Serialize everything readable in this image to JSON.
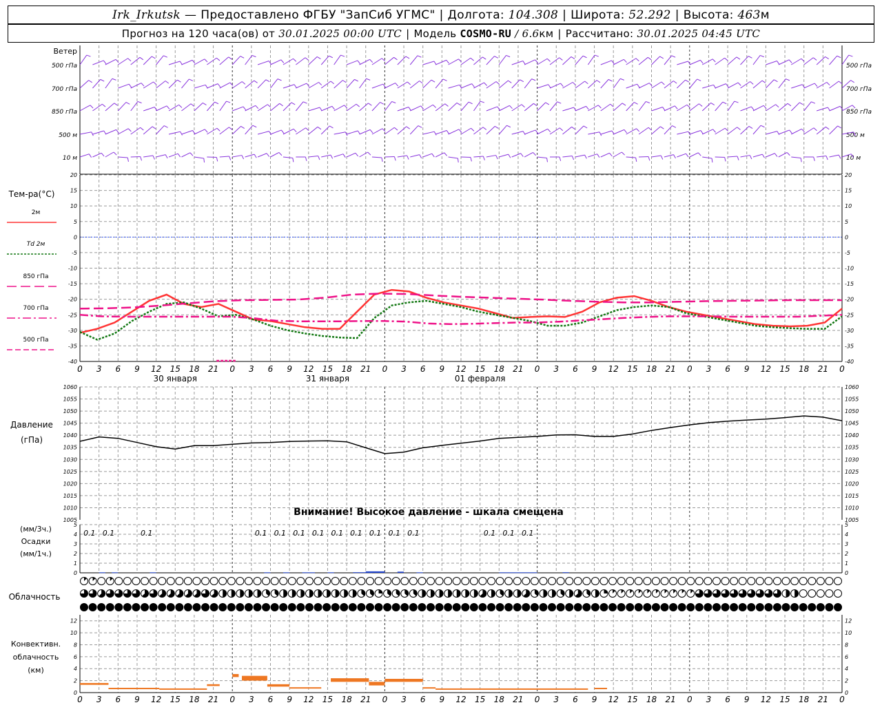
{
  "header": {
    "station": "Irk_Irkutsk",
    "dash": "—",
    "provider": "Предоставлено ФГБУ \"ЗапСиб УГМС\"",
    "lon_label": "Долгота:",
    "lon_value": "104.308",
    "lat_label": "Широта:",
    "lat_value": "52.292",
    "alt_label": "Высота:",
    "alt_value": "463",
    "alt_unit": "м",
    "forecast_prefix": "Прогноз на 120 часа(ов) от",
    "forecast_start": "30.01.2025 00:00 UTC",
    "model_label": "Модель",
    "model_name": "COSMO-RU",
    "model_res": "/ 6.6",
    "model_res_unit": "км",
    "calc_label": "Рассчитано:",
    "calc_time": "30.01.2025 04:45 UTC"
  },
  "chart_data": [
    {
      "type": "wind-barbs",
      "panel": "wind",
      "title": "Ветер",
      "levels": [
        "500 гПа",
        "700 гПа",
        "850 гПа",
        "500 м",
        "10  м"
      ]
    },
    {
      "type": "line",
      "panel": "temperature",
      "title": "Тем-ра(°C)",
      "ylim": [
        -40,
        20
      ],
      "yticks": [
        20,
        15,
        10,
        5,
        0,
        -5,
        -10,
        -15,
        -20,
        -25,
        -30,
        -35,
        -40
      ],
      "x_hours": [
        0,
        3,
        6,
        9,
        12,
        15,
        18,
        21,
        24,
        27,
        30,
        33,
        36,
        39,
        42,
        45,
        48,
        51,
        54,
        57,
        60,
        63,
        66,
        69,
        72,
        75,
        78,
        81,
        84,
        87,
        90,
        93,
        96,
        99,
        102,
        105,
        108,
        111,
        114,
        117,
        120
      ],
      "series": [
        {
          "name": "2м",
          "color": "#ff3333",
          "dash": "solid",
          "values": [
            -30.8,
            -29.5,
            -27.5,
            -24,
            -20.5,
            -18.5,
            -21.5,
            -22.5,
            -21.5,
            -24,
            -26.5,
            -27,
            -28,
            -29,
            -29.5,
            -29.5,
            -24,
            -18.5,
            -17,
            -17.5,
            -19.5,
            -21,
            -22,
            -23,
            -24.5,
            -26,
            -25.7,
            -25.5,
            -25.7,
            -24,
            -21,
            -19.5,
            -19,
            -20.5,
            -22.5,
            -24,
            -25,
            -26,
            -27,
            -28,
            -28.5,
            -28.7,
            -28.5,
            -27.5,
            -23
          ]
        },
        {
          "name": "Td 2м",
          "color": "#117711",
          "dash": "dot",
          "values": [
            -30.5,
            -33,
            -31,
            -27,
            -24,
            -21.5,
            -21,
            -23,
            -25.5,
            -25,
            -26.5,
            -28.5,
            -30,
            -31,
            -31.8,
            -32.3,
            -32.5,
            -26,
            -22,
            -21,
            -20.5,
            -21.5,
            -22.5,
            -24,
            -25,
            -26,
            -27,
            -28.5,
            -28.5,
            -27.5,
            -25.5,
            -23.5,
            -22.5,
            -22,
            -22.5,
            -24.5,
            -25.5,
            -26.5,
            -27.5,
            -28.5,
            -29,
            -29.3,
            -29.5,
            -29.5,
            -25.5
          ]
        },
        {
          "name": "850 гПа",
          "color": "#ee1188",
          "dash": "longdash",
          "values": [
            -23,
            -22.9,
            -22.6,
            -22,
            -21.3,
            -20.6,
            -20.3,
            -20.2,
            -20.1,
            -19.5,
            -18.5,
            -18.2,
            -18.3,
            -18.8,
            -19.2,
            -19.5,
            -19.8,
            -20.1,
            -20.5,
            -20.8,
            -21,
            -21,
            -20.8,
            -20.6,
            -20.5,
            -20.4,
            -20.3,
            -20.3,
            -20.3
          ]
        },
        {
          "name": "700 гПа",
          "color": "#ee1188",
          "dash": "dashdot",
          "values": [
            -25,
            -25.5,
            -25.6,
            -25.6,
            -25.6,
            -25.6,
            -25.6,
            -25.6,
            -26.1,
            -26.9,
            -27.1,
            -27.1,
            -27.1,
            -27,
            -27,
            -27.2,
            -27.8,
            -28,
            -27.9,
            -27.7,
            -27.5,
            -27.5,
            -27.2,
            -26.8,
            -26.4,
            -26,
            -25.7,
            -25.5,
            -25.5,
            -25.5,
            -25.6,
            -25.6,
            -25.6,
            -25.6,
            -25.3,
            -25
          ]
        },
        {
          "name": "500 гПа",
          "color": "#ee1188",
          "dash": "dash",
          "values": [
            -40,
            -40
          ]
        }
      ]
    },
    {
      "type": "line",
      "panel": "pressure",
      "title": "Давление",
      "ylabel": "(гПа)",
      "ylim": [
        1005,
        1060
      ],
      "yticks": [
        1060,
        1055,
        1050,
        1045,
        1040,
        1035,
        1030,
        1025,
        1020,
        1015,
        1010,
        1005
      ],
      "x_hours": [
        0,
        3,
        6,
        9,
        12,
        15,
        18,
        21,
        24,
        27,
        30,
        33,
        36,
        39,
        42,
        45,
        48,
        51,
        54,
        57,
        60,
        63,
        66,
        69,
        72,
        75,
        78,
        81,
        84,
        87,
        90,
        93,
        96,
        99,
        102,
        105,
        108,
        111,
        114,
        117,
        120
      ],
      "series": [
        {
          "name": "",
          "color": "#000000",
          "values": [
            1037.5,
            1039.3,
            1038.7,
            1037,
            1035.3,
            1034.3,
            1035.7,
            1035.7,
            1036.3,
            1036.8,
            1037,
            1037.4,
            1037.6,
            1037.7,
            1037.3,
            1034.8,
            1032.4,
            1033,
            1034.8,
            1035.8,
            1036.7,
            1037.6,
            1038.7,
            1039.1,
            1039.5,
            1040.1,
            1040.2,
            1039.5,
            1039.5,
            1040.5,
            1042,
            1043.2,
            1044.3,
            1045.2,
            1045.8,
            1046.3,
            1046.7,
            1047.3,
            1048,
            1047.5,
            1046
          ]
        }
      ],
      "note": "Внимание! Высокое давление - шкала смещена"
    },
    {
      "type": "bar",
      "panel": "precipitation",
      "title": "Осадки",
      "ylabel_top": "(мм/3ч.)",
      "ylabel_bottom": "(мм/1ч.)",
      "ylim": [
        0,
        5
      ],
      "yticks": [
        5,
        4,
        3,
        2,
        1,
        0
      ],
      "labels": [
        {
          "hour": 1.5,
          "text": "0.1"
        },
        {
          "hour": 4.5,
          "text": "0.1"
        },
        {
          "hour": 10.5,
          "text": "0.1"
        },
        {
          "hour": 28.5,
          "text": "0.1"
        },
        {
          "hour": 31.5,
          "text": "0.1"
        },
        {
          "hour": 34.5,
          "text": "0.1"
        },
        {
          "hour": 37.5,
          "text": "0.1"
        },
        {
          "hour": 40.5,
          "text": "0.1"
        },
        {
          "hour": 43.5,
          "text": "0.1"
        },
        {
          "hour": 46.5,
          "text": "0.1"
        },
        {
          "hour": 49.5,
          "text": "0.1"
        },
        {
          "hour": 52.5,
          "text": "0.1"
        },
        {
          "hour": 64.5,
          "text": "0.1"
        },
        {
          "hour": 67.5,
          "text": "0.1"
        },
        {
          "hour": 70.5,
          "text": "0.1"
        }
      ],
      "bars_mm_per_h": [
        {
          "start": 3,
          "end": 4,
          "value": 0.05
        },
        {
          "start": 5,
          "end": 6,
          "value": 0.05
        },
        {
          "start": 11,
          "end": 12,
          "value": 0.05
        },
        {
          "start": 29,
          "end": 30,
          "value": 0.05
        },
        {
          "start": 32,
          "end": 33,
          "value": 0.05
        },
        {
          "start": 35,
          "end": 37,
          "value": 0.05
        },
        {
          "start": 39,
          "end": 40,
          "value": 0.05
        },
        {
          "start": 43,
          "end": 46,
          "value": 0.06
        },
        {
          "start": 45,
          "end": 48,
          "value": 0.15
        },
        {
          "start": 50,
          "end": 51,
          "value": 0.12
        },
        {
          "start": 53,
          "end": 54,
          "value": 0.05
        },
        {
          "start": 66,
          "end": 72,
          "value": 0.05
        },
        {
          "start": 76,
          "end": 77,
          "value": 0.06
        }
      ]
    },
    {
      "type": "symbols",
      "panel": "cloudiness",
      "title": "Облачность",
      "rows": [
        "1101000000000000000000000000000000000000000000000000000000000000000000000000000000000000000000000000000000000000000000000000",
        "6656666565555565444443344444444433233334444444543445344345342111111111166666666664400",
        "8888888888888888888888888888888888888888888888888888888888888888888888888888888888888888"
      ]
    },
    {
      "type": "bar",
      "panel": "convective",
      "title_lines": [
        "Конвективн.",
        "облачность",
        "(км)"
      ],
      "ylim": [
        0,
        13
      ],
      "yticks": [
        12,
        10,
        8,
        6,
        4,
        2,
        0
      ],
      "segments_km": [
        {
          "start": 0,
          "end": 4.5,
          "bottom": 1.3,
          "top": 1.6
        },
        {
          "start": 4.5,
          "end": 12.5,
          "bottom": 0.6,
          "top": 0.8
        },
        {
          "start": 12.5,
          "end": 20,
          "bottom": 0.5,
          "top": 0.7
        },
        {
          "start": 20,
          "end": 22,
          "bottom": 1.1,
          "top": 1.4
        },
        {
          "start": 24,
          "end": 25,
          "bottom": 2.6,
          "top": 3.1
        },
        {
          "start": 25.5,
          "end": 29.5,
          "bottom": 2.0,
          "top": 2.8
        },
        {
          "start": 29.5,
          "end": 33,
          "bottom": 1.0,
          "top": 1.4
        },
        {
          "start": 33,
          "end": 38,
          "bottom": 0.7,
          "top": 0.9
        },
        {
          "start": 39.5,
          "end": 45.5,
          "bottom": 1.8,
          "top": 2.4
        },
        {
          "start": 45.5,
          "end": 48,
          "bottom": 1.2,
          "top": 1.8
        },
        {
          "start": 48,
          "end": 54,
          "bottom": 1.8,
          "top": 2.3
        },
        {
          "start": 54,
          "end": 56,
          "bottom": 0.7,
          "top": 0.9
        },
        {
          "start": 56,
          "end": 66,
          "bottom": 0.5,
          "top": 0.7
        },
        {
          "start": 66,
          "end": 80,
          "bottom": 0.5,
          "top": 0.7
        },
        {
          "start": 81,
          "end": 83,
          "bottom": 0.6,
          "top": 0.8
        }
      ]
    }
  ],
  "temp_legend": [
    {
      "label": "2м",
      "color": "#ff3333",
      "dash": "solid"
    },
    {
      "label": "Td  2м",
      "color": "#117711",
      "dash": "dot"
    },
    {
      "label": "850 гПа",
      "color": "#ee1188",
      "dash": "longdash"
    },
    {
      "label": "700 гПа",
      "color": "#ee1188",
      "dash": "dashdot"
    },
    {
      "label": "500 гПа",
      "color": "#ee1188",
      "dash": "dash"
    }
  ],
  "x_axis": {
    "tick_hours": [
      0,
      3,
      6,
      9,
      12,
      15,
      18,
      21,
      24,
      27,
      30,
      33,
      36,
      39,
      42,
      45,
      48,
      51,
      54,
      57,
      60,
      63,
      66,
      69,
      72,
      75,
      78,
      81,
      84,
      87,
      90,
      93,
      96,
      99,
      102,
      105,
      108,
      111,
      114,
      117,
      120
    ],
    "tick_labels": [
      "0",
      "3",
      "6",
      "9",
      "12",
      "15",
      "18",
      "21",
      "0",
      "3",
      "6",
      "9",
      "12",
      "15",
      "18",
      "21",
      "0",
      "3",
      "6",
      "9",
      "12",
      "15",
      "18",
      "21",
      "0",
      "3",
      "6",
      "9",
      "12",
      "15",
      "18",
      "21",
      "0",
      "3",
      "6",
      "9",
      "12",
      "15",
      "18",
      "21",
      "0",
      "3",
      "6"
    ],
    "day_labels": [
      {
        "hour": 15,
        "text": "30 января"
      },
      {
        "hour": 39,
        "text": "31 января"
      },
      {
        "hour": 63,
        "text": "01 февраля"
      }
    ]
  },
  "colors": {
    "wind": "#8833dd",
    "grid": "#999999",
    "precip": "#2244cc",
    "convective": "#ee7722",
    "zero_line": "#3355ff"
  }
}
